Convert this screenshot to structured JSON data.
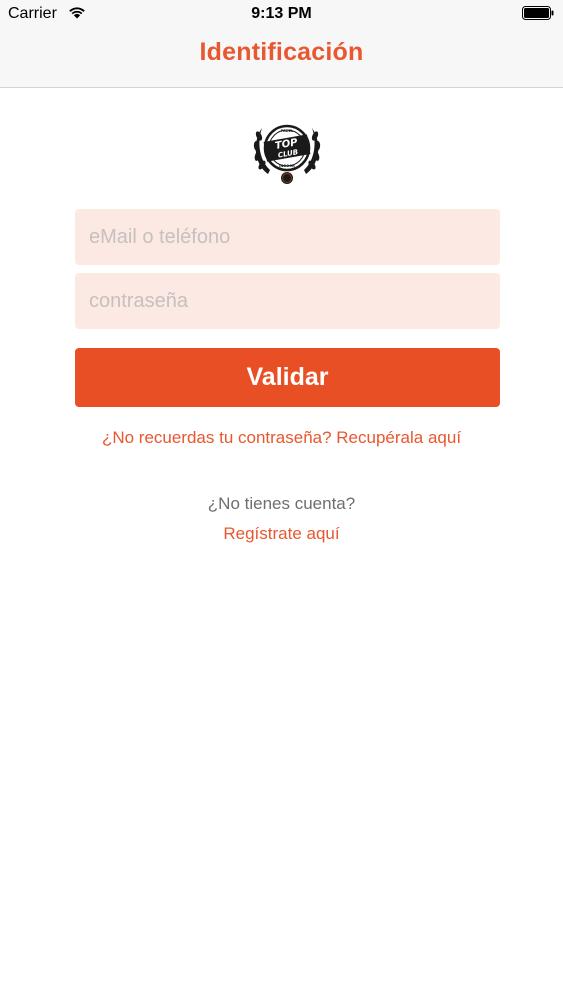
{
  "status_bar": {
    "carrier": "Carrier",
    "time": "9:13 PM",
    "wifi_icon": "wifi-icon",
    "battery_icon": "battery-full-icon"
  },
  "nav": {
    "title": "Identificación"
  },
  "logo": {
    "icon": "top-club-logo",
    "text_top": "TOP",
    "text_bottom": "CLUB",
    "text_upper_arc": "PADEL",
    "text_lower_arc": "INDOOR"
  },
  "form": {
    "email_placeholder": "eMail o teléfono",
    "email_value": "",
    "password_placeholder": "contraseña",
    "password_value": "",
    "validate_label": "Validar"
  },
  "links": {
    "forgot_password": "¿No recuerdas tu contraseña? Recupérala aquí",
    "no_account": "¿No tienes cuenta?",
    "register": "Regístrate aquí"
  },
  "colors": {
    "accent": "#e8572f",
    "button": "#e84f24",
    "field_bg": "#fde9e4"
  }
}
